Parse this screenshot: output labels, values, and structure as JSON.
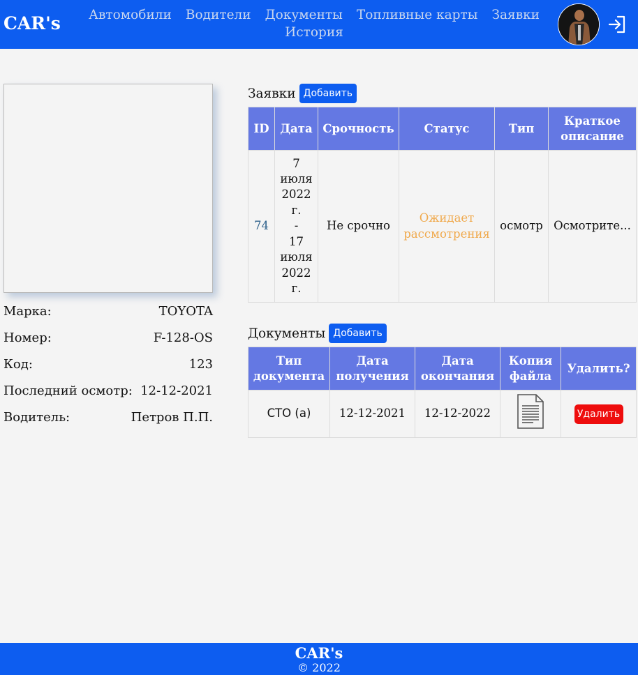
{
  "header": {
    "logo": "CAR's",
    "nav": {
      "row1": [
        "Автомобили",
        "Водители",
        "Документы",
        "Топливные карты",
        "Заявки"
      ],
      "row2": [
        "История"
      ]
    },
    "icons": {
      "avatar": "user-avatar",
      "logout": "logout-icon"
    }
  },
  "car": {
    "rows": [
      {
        "label": "Марка:",
        "value": "TOYOTA"
      },
      {
        "label": "Номер:",
        "value": "F-128-OS"
      },
      {
        "label": "Код:",
        "value": "123"
      },
      {
        "label": "Последний осмотр:",
        "value": "12-12-2021"
      },
      {
        "label": "Водитель:",
        "value": "Петров П.П."
      }
    ]
  },
  "requests": {
    "title": "Заявки",
    "add_label": "Добавить",
    "headers": [
      "ID",
      "Дата",
      "Срочность",
      "Статус",
      "Тип",
      "Краткое описание"
    ],
    "rows": [
      {
        "id": "74",
        "date_lines": [
          "7",
          "июля",
          "2022",
          "г.",
          "-",
          "17",
          "июля",
          "2022",
          "г."
        ],
        "urgency": "Не срочно",
        "status": "Ожидает рассмотрения",
        "type": "осмотр",
        "description": "Осмотрите..."
      }
    ]
  },
  "documents": {
    "title": "Документы",
    "add_label": "Добавить",
    "headers": [
      "Тип документа",
      "Дата получения",
      "Дата окончания",
      "Копия файла",
      "Удалить?"
    ],
    "rows": [
      {
        "doc_type": "СТО (а)",
        "received": "12-12-2021",
        "expires": "12-12-2022",
        "file_icon": "document-file-icon",
        "delete_label": "Удалить"
      }
    ]
  },
  "footer": {
    "brand": "CAR's",
    "copyright": "© 2022"
  },
  "colors": {
    "brand": "#0d5df0",
    "table_header": "#6478e3",
    "status_pending": "#f0a94c",
    "delete": "#ee0d0d"
  }
}
